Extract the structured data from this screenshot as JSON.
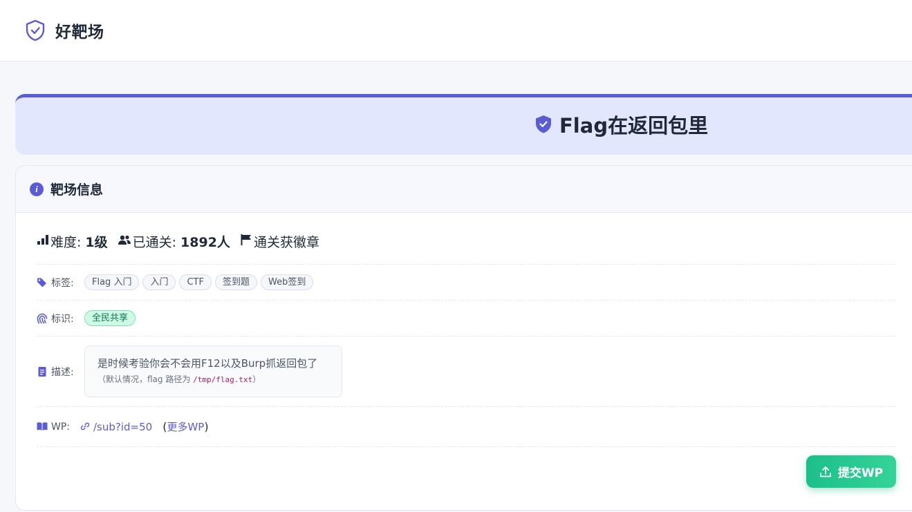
{
  "brand": {
    "name": "好靶场"
  },
  "banner": {
    "title": "Flag在返回包里"
  },
  "card": {
    "title": "靶场信息",
    "stats": {
      "difficulty_label": "难度:",
      "difficulty_value": "1级",
      "passed_label": "已通关:",
      "passed_value": "1892人",
      "badge_text": "通关获徽章"
    },
    "tags_label": "标签:",
    "tags": [
      "Flag 入门",
      "入门",
      "CTF",
      "签到题",
      "Web签到"
    ],
    "mark_label": "标识:",
    "mark_badge": "全民共享",
    "desc_label": "描述:",
    "desc_main": "是时候考验你会不会用F12以及Burp抓返回包了",
    "desc_note_prefix": "（默认情况，flag 路径为 ",
    "desc_note_path": "/tmp/flag.txt",
    "desc_note_suffix": "）",
    "wp_label": "WP:",
    "wp_link": "/sub?id=50",
    "wp_more_open": "(",
    "wp_more_link": "更多WP",
    "wp_more_close": ")"
  },
  "submit_button": {
    "label": "提交WP"
  },
  "colors": {
    "accent": "#5b5bd6",
    "success": "#1cbf8a",
    "banner_bg": "#e2e7fd"
  }
}
